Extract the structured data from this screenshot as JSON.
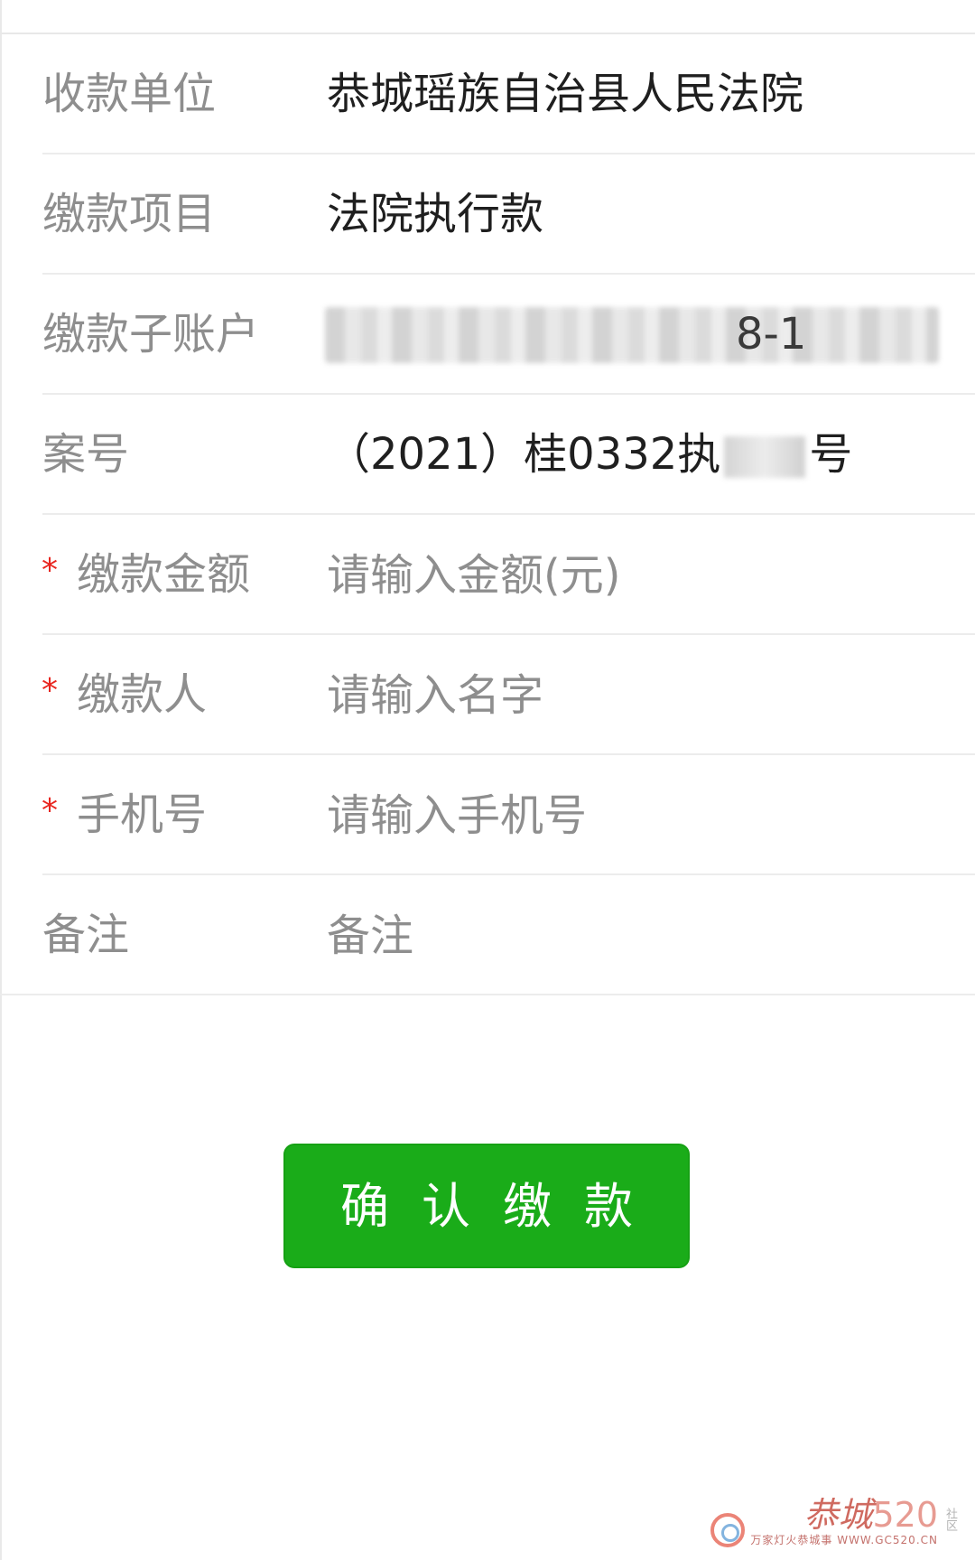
{
  "form": {
    "rows": [
      {
        "label": "收款单位",
        "value": "恭城瑶族自治县人民法院"
      },
      {
        "label": "缴款项目",
        "value": "法院执行款"
      },
      {
        "label": "缴款子账户",
        "value": "8-1"
      },
      {
        "label": "案号",
        "value_prefix": "（2021）桂0332执",
        "value_suffix": "号"
      },
      {
        "label": "缴款金额",
        "required": true,
        "placeholder": "请输入金额(元)"
      },
      {
        "label": "缴款人",
        "required": true,
        "placeholder": "请输入名字"
      },
      {
        "label": "手机号",
        "required": true,
        "placeholder": "请输入手机号"
      },
      {
        "label": "备注",
        "placeholder": "备注"
      }
    ],
    "required_mark": "*"
  },
  "button": {
    "label": "确认缴款",
    "color": "#1aac19"
  },
  "watermark": {
    "brand": "恭城",
    "number": "520",
    "side": "社区",
    "sub": "万家灯火恭城事 WWW.GC520.CN"
  },
  "colors": {
    "label": "#8e8e8e",
    "value": "#1f1f1f",
    "required": "#e8251f",
    "divider": "#ececec"
  }
}
